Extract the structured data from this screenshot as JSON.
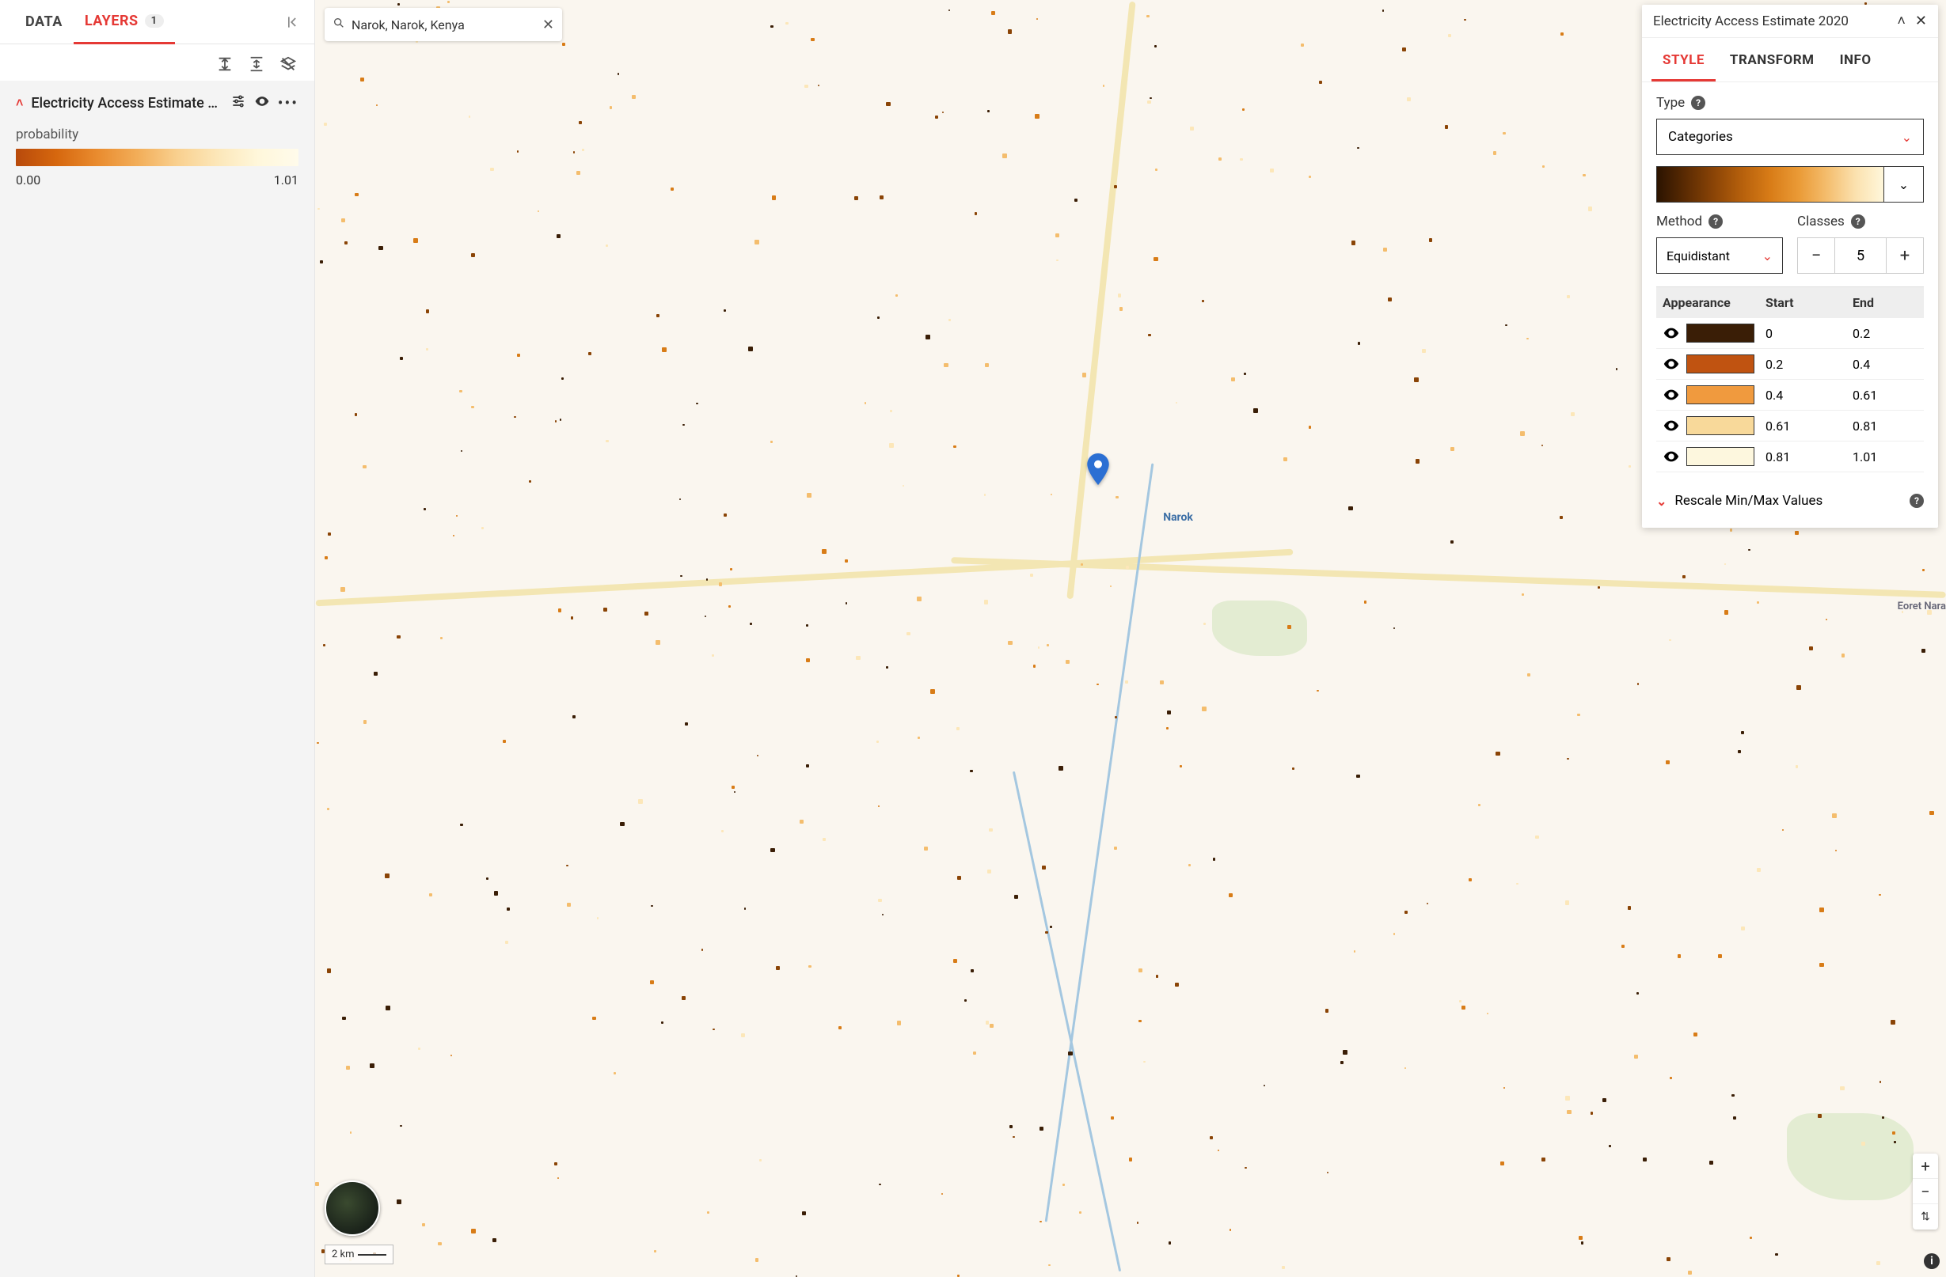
{
  "sidebar": {
    "tabs": {
      "data": "DATA",
      "layers": "LAYERS",
      "layers_count": "1"
    },
    "layer": {
      "title": "Electricity Access Estimate 2…",
      "legend_label": "probability",
      "legend_min": "0.00",
      "legend_max": "1.01"
    }
  },
  "search": {
    "value": "Narok, Narok, Kenya"
  },
  "map": {
    "marker_label": "Narok",
    "right_label": "Eoret Nara",
    "scale_label": "2 km"
  },
  "panel": {
    "title": "Electricity Access Estimate 2020",
    "tabs": {
      "style": "STYLE",
      "transform": "TRANSFORM",
      "info": "INFO"
    },
    "type_label": "Type",
    "type_value": "Categories",
    "method_label": "Method",
    "classes_label": "Classes",
    "method_value": "Equidistant",
    "classes_value": "5",
    "table_headers": {
      "appearance": "Appearance",
      "start": "Start",
      "end": "End"
    },
    "classes": [
      {
        "color": "#3a1e06",
        "start": "0",
        "end": "0.2"
      },
      {
        "color": "#c05311",
        "start": "0.2",
        "end": "0.4"
      },
      {
        "color": "#f09a3e",
        "start": "0.4",
        "end": "0.61"
      },
      {
        "color": "#f8d99a",
        "start": "0.61",
        "end": "0.81"
      },
      {
        "color": "#fdf7de",
        "start": "0.81",
        "end": "1.01"
      }
    ],
    "rescale_label": "Rescale Min/Max Values"
  }
}
